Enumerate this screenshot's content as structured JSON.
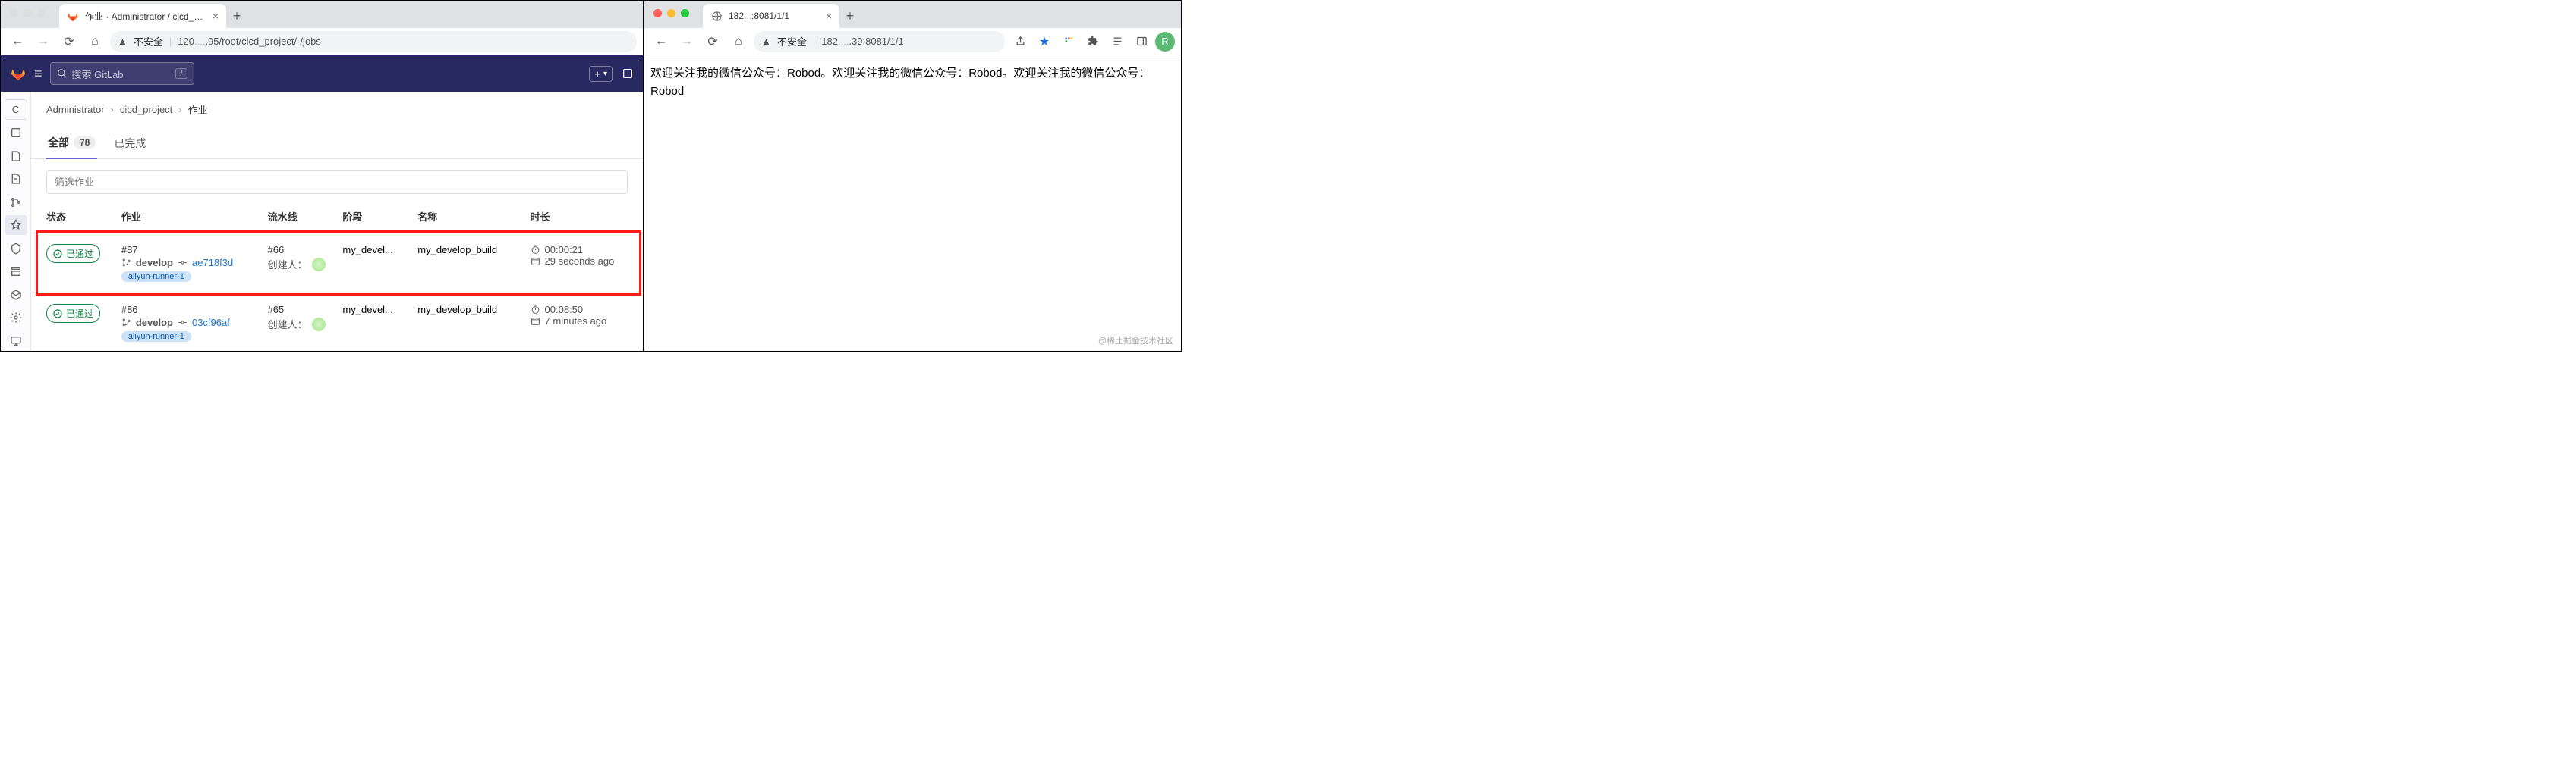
{
  "left_window": {
    "tab": {
      "title": "作业 · Administrator / cicd_pro…"
    },
    "address": {
      "secure_label": "不安全",
      "url_prefix": "120",
      "url_mid": ".95/root/cicd_project/-/jobs"
    },
    "gitlab": {
      "search_placeholder": "搜索 GitLab",
      "search_shortcut": "/",
      "breadcrumb": {
        "a": "Administrator",
        "b": "cicd_project",
        "c": "作业"
      },
      "tabs": {
        "all": "全部",
        "all_count": "78",
        "done": "已完成"
      },
      "filter_placeholder": "筛选作业",
      "columns": {
        "status": "状态",
        "job": "作业",
        "pipeline": "流水线",
        "stage": "阶段",
        "name": "名称",
        "duration": "时长"
      },
      "rows": [
        {
          "status": "已通过",
          "job_id": "#87",
          "branch": "develop",
          "sha": "ae718f3d",
          "runner": "aliyun-runner-1",
          "pipeline_id": "#66",
          "creator_label": "创建人：",
          "stage": "my_devel...",
          "name": "my_develop_build",
          "duration": "00:00:21",
          "ago": "29 seconds ago",
          "highlighted": true
        },
        {
          "status": "已通过",
          "job_id": "#86",
          "branch": "develop",
          "sha": "03cf96af",
          "runner": "aliyun-runner-1",
          "pipeline_id": "#65",
          "creator_label": "创建人：",
          "stage": "my_devel...",
          "name": "my_develop_build",
          "duration": "00:08:50",
          "ago": "7 minutes ago",
          "highlighted": false
        }
      ],
      "sidebar_letter": "C"
    }
  },
  "right_window": {
    "tab": {
      "title_prefix": "182.",
      "title_suffix": ":8081/1/1"
    },
    "address": {
      "secure_label": "不安全",
      "url_prefix": "182",
      "url_suffix": ".39:8081/1/1"
    },
    "avatar_letter": "R",
    "content": "欢迎关注我的微信公众号：Robod。欢迎关注我的微信公众号：Robod。欢迎关注我的微信公众号：Robod",
    "watermark": "@稀土掘金技术社区"
  }
}
